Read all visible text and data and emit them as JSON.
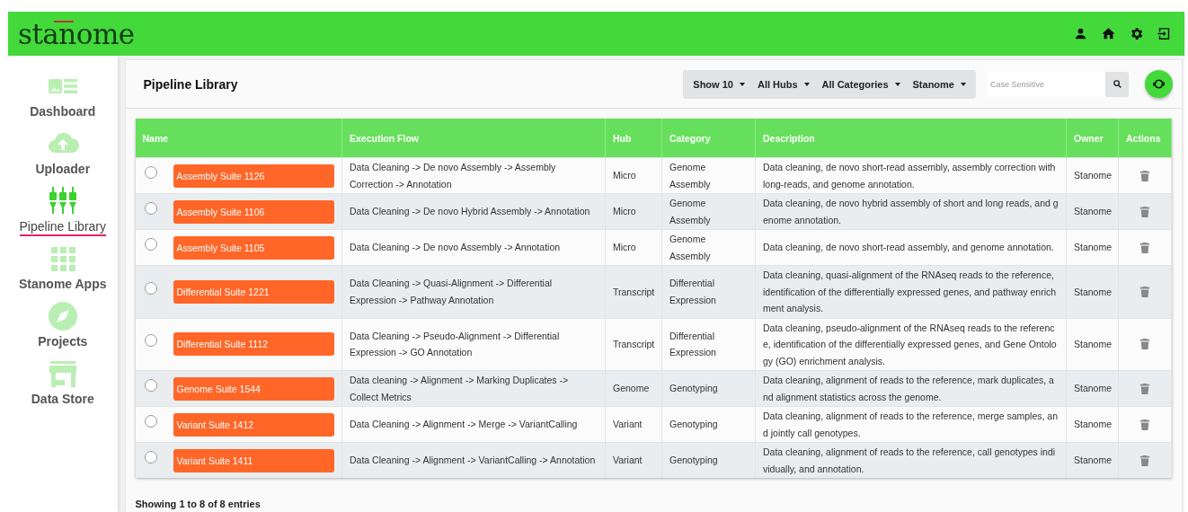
{
  "header": {
    "logo": "stanome"
  },
  "sidebar": {
    "items": [
      {
        "label": "Dashboard",
        "kind": "dashboard",
        "selected": false
      },
      {
        "label": "Uploader",
        "kind": "upload",
        "selected": false
      },
      {
        "label": "Pipeline Library",
        "kind": "pipeline",
        "selected": true
      },
      {
        "label": "Stanome Apps",
        "kind": "apps",
        "selected": false
      },
      {
        "label": "Projects",
        "kind": "compass",
        "selected": false
      },
      {
        "label": "Data Store",
        "kind": "store",
        "selected": false
      }
    ]
  },
  "page": {
    "title": "Pipeline Library",
    "filters": [
      "Show 10",
      "All Hubs",
      "All Categories",
      "Stanome"
    ],
    "search": {
      "placeholder": "Case Sensitive"
    }
  },
  "table": {
    "columns": [
      "Name",
      "Execution Flow",
      "Hub",
      "Category",
      "Description",
      "Owner",
      "Actions"
    ],
    "rows": [
      {
        "selected": false,
        "name": "Assembly Suite 1126",
        "flow": "Data Cleaning -> De novo Assembly -> Assembly Correction -> Annotation",
        "hub": "Micro",
        "category": "Genome Assembly",
        "description": "Data cleaning, de novo short-read assembly, assembly correction with long-reads, and genome annotation.",
        "owner": "Stanome"
      },
      {
        "selected": false,
        "name": "Assembly Suite 1106",
        "flow": "Data Cleaning -> De novo Hybrid Assembly -> Annotation",
        "hub": "Micro",
        "category": "Genome Assembly",
        "description": "Data cleaning, de novo hybrid assembly of short and long reads, and genome annotation.",
        "owner": "Stanome"
      },
      {
        "selected": false,
        "name": "Assembly Suite 1105",
        "flow": "Data Cleaning -> De novo Assembly -> Annotation",
        "hub": "Micro",
        "category": "Genome Assembly",
        "description": "Data cleaning, de novo short-read assembly, and genome annotation.",
        "owner": "Stanome"
      },
      {
        "selected": false,
        "name": "Differential Suite 1221",
        "flow": "Data Cleaning -> Quasi-Alignment -> Differential Expression -> Pathway Annotation",
        "hub": "Transcript",
        "category": "Differential Expression",
        "description": "Data cleaning, quasi-alignment of the RNAseq reads to the reference, identification of the differentially expressed genes, and pathway enrichment analysis.",
        "owner": "Stanome"
      },
      {
        "selected": false,
        "name": "Differential Suite 1112",
        "flow": "Data Cleaning -> Pseudo-Alignment -> Differential Expression -> GO Annotation",
        "hub": "Transcript",
        "category": "Differential Expression",
        "description": "Data cleaning, pseudo-alignment of the RNAseq reads to the reference, identification of the differentially expressed genes, and Gene Ontology (GO) enrichment analysis.",
        "owner": "Stanome"
      },
      {
        "selected": false,
        "name": "Genome Suite 1544",
        "flow": "Data cleaning -> Alignment -> Marking Duplicates -> Collect Metrics",
        "hub": "Genome",
        "category": "Genotyping",
        "description": "Data cleaning, alignment of reads to the reference, mark duplicates, and alignment statistics across the genome.",
        "owner": "Stanome"
      },
      {
        "selected": false,
        "name": "Variant Suite 1412",
        "flow": "Data Cleaning -> Alignment -> Merge -> VariantCalling",
        "hub": "Variant",
        "category": "Genotyping",
        "description": "Data cleaning, alignment of reads to the reference, merge samples, and jointly call genotypes.",
        "owner": "Stanome"
      },
      {
        "selected": false,
        "name": "Variant Suite 1411",
        "flow": "Data Cleaning -> Alignment -> VariantCalling -> Annotation",
        "hub": "Variant",
        "category": "Genotyping",
        "description": "Data cleaning, alignment of reads to the reference, call genotypes individually, and annotation.",
        "owner": "Stanome"
      }
    ]
  },
  "footer": {
    "summary": "Showing 1 to 8 of 8 entries"
  }
}
